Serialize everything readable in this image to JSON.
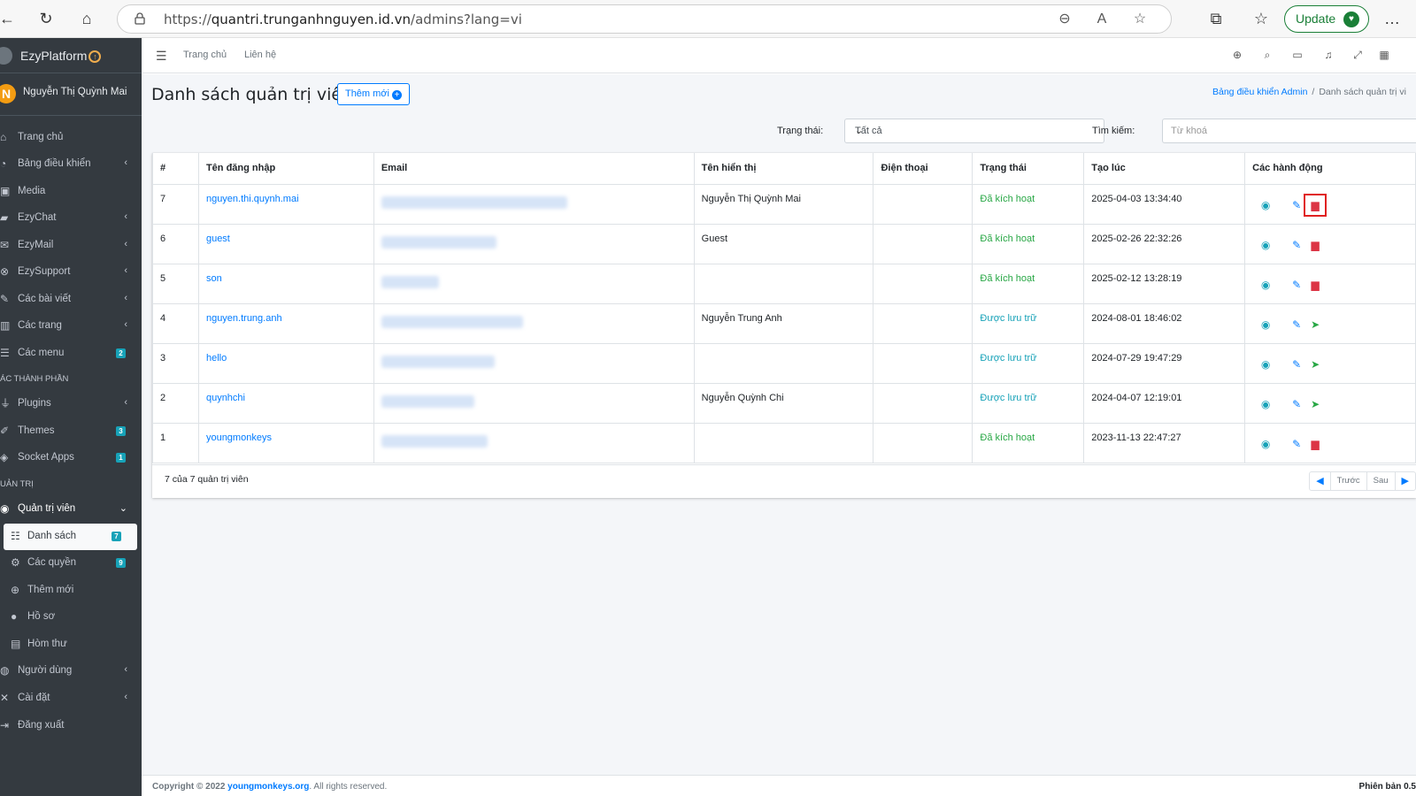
{
  "browser": {
    "url_prefix": "https://",
    "url_host": "quantri.trunganhnguyen.id.vn",
    "url_path": "/admins?lang=vi",
    "update_label": "Update"
  },
  "sidebar": {
    "brand": "EzyPlatform",
    "user_initial": "N",
    "user_name": "Nguyễn Thị Quỳnh Mai",
    "items": [
      {
        "label": "Trang chủ",
        "icon": "home-icon"
      },
      {
        "label": "Bảng điều khiển",
        "icon": "dashboard-icon"
      },
      {
        "label": "Media",
        "icon": "image-icon"
      },
      {
        "label": "EzyChat",
        "icon": "chat-icon"
      },
      {
        "label": "EzyMail",
        "icon": "mail-icon"
      },
      {
        "label": "EzySupport",
        "icon": "lifebuoy-icon"
      },
      {
        "label": "Các bài viết",
        "icon": "edit-icon"
      },
      {
        "label": "Các trang",
        "icon": "columns-icon"
      },
      {
        "label": "Các menu",
        "icon": "bars-icon",
        "badge": "2"
      },
      {
        "label": "Plugins",
        "icon": "plug-icon"
      },
      {
        "label": "Themes",
        "icon": "brush-icon",
        "badge": "3"
      },
      {
        "label": "Socket Apps",
        "icon": "app-icon",
        "badge": "1"
      },
      {
        "label": "Quản trị viên",
        "icon": "user-circle-icon"
      },
      {
        "label": "Danh sách",
        "icon": "list-icon",
        "badge": "7"
      },
      {
        "label": "Các quyền",
        "icon": "users-cog-icon",
        "badge": "9"
      },
      {
        "label": "Thêm mới",
        "icon": "plus-circle-icon"
      },
      {
        "label": "Hồ sơ",
        "icon": "user-icon"
      },
      {
        "label": "Hòm thư",
        "icon": "inbox-icon"
      },
      {
        "label": "Người dùng",
        "icon": "users-icon"
      },
      {
        "label": "Cài đặt",
        "icon": "tools-icon"
      },
      {
        "label": "Đăng xuất",
        "icon": "sign-out-icon"
      }
    ],
    "header_components": "ÁC THÀNH PHẦN",
    "header_admin": "UẢN TRỊ"
  },
  "topnav": {
    "home": "Trang chủ",
    "contact": "Liên hệ"
  },
  "page": {
    "title": "Danh sách quản trị viên",
    "add_button": "Thêm mới",
    "breadcrumb_link": "Bảng điều khiển Admin",
    "breadcrumb_sep": "/",
    "breadcrumb_current": "Danh sách quản trị vi",
    "status_label": "Trạng thái:",
    "status_value": "Tất cả",
    "search_label": "Tìm kiếm:",
    "search_placeholder": "Từ khoá"
  },
  "table": {
    "headers": [
      "#",
      "Tên đăng nhập",
      "Email",
      "Tên hiển thị",
      "Điện thoại",
      "Trạng thái",
      "Tạo lúc",
      "Các hành động"
    ],
    "rows": [
      {
        "id": "7",
        "username": "nguyen.thi.quynh.mai",
        "display": "Nguyễn Thị Quỳnh Mai",
        "phone": "",
        "status": "Đã kích hoạt",
        "created": "2025-04-03 13:34:40",
        "action": "archive"
      },
      {
        "id": "6",
        "username": "guest",
        "display": "Guest",
        "phone": "",
        "status": "Đã kích hoạt",
        "created": "2025-02-26 22:32:26",
        "action": "archive"
      },
      {
        "id": "5",
        "username": "son",
        "display": "",
        "phone": "",
        "status": "Đã kích hoạt",
        "created": "2025-02-12 13:28:19",
        "action": "archive"
      },
      {
        "id": "4",
        "username": "nguyen.trung.anh",
        "display": "Nguyễn Trung Anh",
        "phone": "",
        "status": "Được lưu trữ",
        "created": "2024-08-01 18:46:02",
        "action": "send"
      },
      {
        "id": "3",
        "username": "hello",
        "display": "",
        "phone": "",
        "status": "Được lưu trữ",
        "created": "2024-07-29 19:47:29",
        "action": "send"
      },
      {
        "id": "2",
        "username": "quynhchi",
        "display": "Nguyễn Quỳnh Chi",
        "phone": "",
        "status": "Được lưu trữ",
        "created": "2024-04-07 12:19:01",
        "action": "send"
      },
      {
        "id": "1",
        "username": "youngmonkeys",
        "display": "",
        "phone": "",
        "status": "Đã kích hoạt",
        "created": "2023-11-13 22:47:27",
        "action": "archive"
      }
    ],
    "count_text": "7 của 7 quản trị viên",
    "prev": "Trước",
    "next": "Sau"
  },
  "footer": {
    "copyright": "Copyright © 2022",
    "org": "youngmonkeys.org",
    "rights": ". All rights reserved.",
    "version": "Phiên bản 0.5"
  },
  "colors": {
    "sidebar_bg": "#343a40",
    "primary": "#007bff",
    "success": "#28a745",
    "info": "#17a2b8",
    "danger": "#dc3545"
  }
}
